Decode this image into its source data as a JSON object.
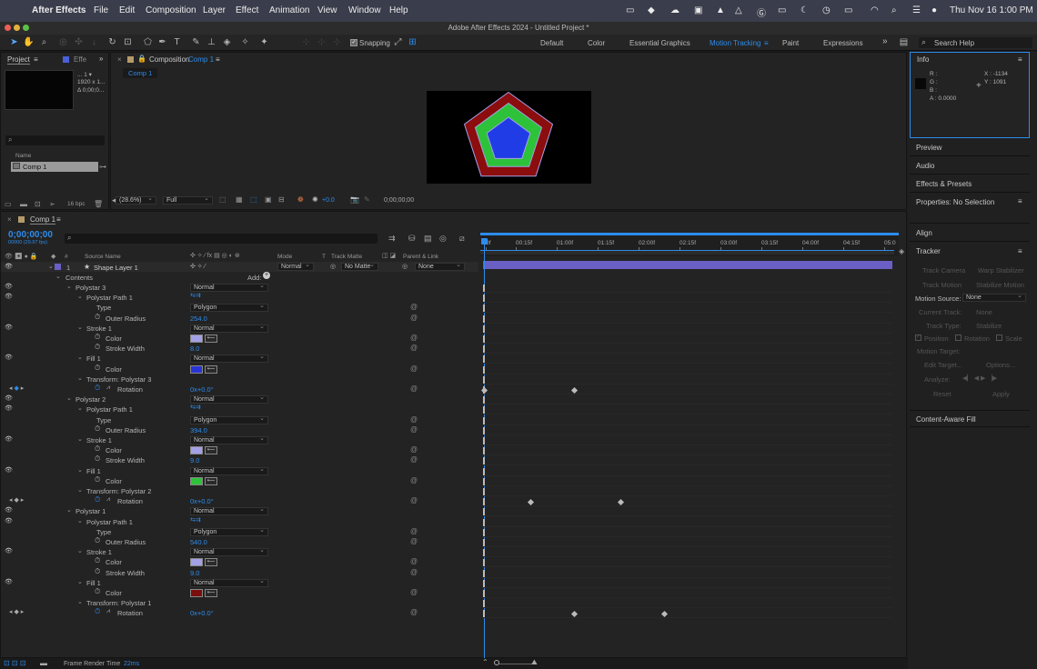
{
  "menubar": {
    "app": "After Effects",
    "items": [
      "File",
      "Edit",
      "Composition",
      "Layer",
      "Effect",
      "Animation",
      "View",
      "Window",
      "Help"
    ],
    "datetime": "Thu Nov 16  1:00 PM"
  },
  "window": {
    "title": "Adobe After Effects 2024 - Untitled Project *"
  },
  "toolbar": {
    "snapping": "Snapping",
    "workspaces": [
      "Default",
      "Color",
      "Essential Graphics",
      "Motion Tracking",
      "Paint",
      "Expressions"
    ],
    "active_workspace": "Motion Tracking",
    "more": "»",
    "search_placeholder": "Search Help"
  },
  "project": {
    "tab": "Project",
    "effects_tab": "Effe",
    "thumb_info": [
      "... 1 ▾",
      "1920 x 1...",
      "Δ 0;00;0..."
    ],
    "name_header": "Name",
    "item": "Comp 1",
    "bpc": "16 bpc"
  },
  "composition": {
    "tab_prefix": "Composition",
    "tab_name": "Comp 1",
    "breadcrumb": "Comp 1",
    "zoom": "(28.6%)",
    "resolution": "Full",
    "exposure": "+0.0",
    "timecode": "0;00;00;00"
  },
  "timeline": {
    "tab": "Comp 1",
    "timecode": "0;00;00;00",
    "fps": "00000 (29.97 fps)",
    "search_placeholder": "",
    "headers": {
      "num": "#",
      "source": "Source Name",
      "mode": "Mode",
      "t": "T",
      "trackmatte": "Track Matte",
      "parent": "Parent & Link"
    },
    "layer": {
      "num": "1",
      "name": "Shape Layer 1",
      "mode": "Normal",
      "matte": "No Matte",
      "parent": "None"
    },
    "contents": "Contents",
    "add": "Add:",
    "ruler": [
      "0f",
      "00:15f",
      "01:00f",
      "01:15f",
      "02:00f",
      "02:15f",
      "03:00f",
      "03:15f",
      "04:00f",
      "04:15f",
      "05:0"
    ],
    "rows": [
      {
        "indent": 1,
        "label": "Polystar 3",
        "dd": "Normal",
        "eye": true
      },
      {
        "indent": 2,
        "label": "Polystar Path 1",
        "pathicon": true,
        "eye": true
      },
      {
        "indent": 3,
        "label": "Type",
        "dd": "Polygon",
        "spiral": true
      },
      {
        "indent": 3,
        "label": "Outer Radius",
        "value": "254.0",
        "stop": true,
        "spiral": true
      },
      {
        "indent": 2,
        "label": "Stroke 1",
        "dd": "Normal",
        "eye": true
      },
      {
        "indent": 3,
        "label": "Color",
        "color": "#a3a0e6",
        "stop": true,
        "spiral": true
      },
      {
        "indent": 3,
        "label": "Stroke Width",
        "value": "8.0",
        "stop": true,
        "spiral": true
      },
      {
        "indent": 2,
        "label": "Fill 1",
        "dd": "Normal",
        "eye": true
      },
      {
        "indent": 3,
        "label": "Color",
        "color": "#2a34d4",
        "stop": true,
        "spiral": true
      },
      {
        "indent": 2,
        "label": "Transform: Polystar 3"
      },
      {
        "indent": 3,
        "label": "Rotation",
        "value": "0x+0.0°",
        "stop": true,
        "graph": true,
        "spiral": true,
        "keynav": true,
        "kfs": [
          531,
          630
        ]
      },
      {
        "indent": 1,
        "label": "Polystar 2",
        "dd": "Normal",
        "eye": true
      },
      {
        "indent": 2,
        "label": "Polystar Path 1",
        "pathicon": true,
        "eye": true
      },
      {
        "indent": 3,
        "label": "Type",
        "dd": "Polygon",
        "spiral": true
      },
      {
        "indent": 3,
        "label": "Outer Radius",
        "value": "394.0",
        "stop": true,
        "spiral": true
      },
      {
        "indent": 2,
        "label": "Stroke 1",
        "dd": "Normal",
        "eye": true
      },
      {
        "indent": 3,
        "label": "Color",
        "color": "#a3a0e6",
        "stop": true,
        "spiral": true
      },
      {
        "indent": 3,
        "label": "Stroke Width",
        "value": "9.0",
        "stop": true,
        "spiral": true
      },
      {
        "indent": 2,
        "label": "Fill 1",
        "dd": "Normal",
        "eye": true
      },
      {
        "indent": 3,
        "label": "Color",
        "color": "#2ec23a",
        "stop": true,
        "spiral": true
      },
      {
        "indent": 2,
        "label": "Transform: Polystar 2"
      },
      {
        "indent": 3,
        "label": "Rotation",
        "value": "0x+0.0°",
        "stop": true,
        "graph": true,
        "spiral": true,
        "keynav": true,
        "kfs": [
          582,
          681
        ]
      },
      {
        "indent": 1,
        "label": "Polystar 1",
        "dd": "Normal",
        "eye": true
      },
      {
        "indent": 2,
        "label": "Polystar Path 1",
        "pathicon": true,
        "eye": true
      },
      {
        "indent": 3,
        "label": "Type",
        "dd": "Polygon",
        "spiral": true
      },
      {
        "indent": 3,
        "label": "Outer Radius",
        "value": "540.0",
        "stop": true,
        "spiral": true
      },
      {
        "indent": 2,
        "label": "Stroke 1",
        "dd": "Normal",
        "eye": true
      },
      {
        "indent": 3,
        "label": "Color",
        "color": "#a3a0e6",
        "stop": true,
        "spiral": true
      },
      {
        "indent": 3,
        "label": "Stroke Width",
        "value": "9.0",
        "stop": true,
        "spiral": true
      },
      {
        "indent": 2,
        "label": "Fill 1",
        "dd": "Normal",
        "eye": true
      },
      {
        "indent": 3,
        "label": "Color",
        "color": "#7a0e0e",
        "stop": true,
        "spiral": true
      },
      {
        "indent": 2,
        "label": "Transform: Polystar 1"
      },
      {
        "indent": 3,
        "label": "Rotation",
        "value": "0x+0.0°",
        "stop": true,
        "graph": true,
        "spiral": true,
        "keynav": true,
        "kfs": [
          630,
          729
        ]
      }
    ],
    "status": {
      "label": "Frame Render Time",
      "value": "22ms"
    }
  },
  "info": {
    "tab": "Info",
    "r": "R :",
    "g": "G :",
    "b": "B :",
    "a": "A :  0.0000",
    "x": "X : -1134",
    "y": "Y : 1091"
  },
  "right_panels": {
    "preview": "Preview",
    "audio": "Audio",
    "effects": "Effects & Presets",
    "properties": "Properties: No Selection",
    "align": "Align",
    "tracker": "Tracker",
    "content_aware": "Content-Aware Fill"
  },
  "tracker": {
    "track_camera": "Track Camera",
    "warp": "Warp Stabilizer",
    "track_motion": "Track Motion",
    "stabilize": "Stabilize Motion",
    "motion_source_label": "Motion Source:",
    "motion_source": "None",
    "current_track_label": "Current Track:",
    "current_track": "None",
    "track_type_label": "Track Type:",
    "track_type": "Stabilize",
    "position": "Position",
    "rotation": "Rotation",
    "scale": "Scale",
    "motion_target": "Motion Target:",
    "edit_target": "Edit Target...",
    "options": "Options...",
    "analyze": "Analyze:",
    "reset": "Reset",
    "apply": "Apply"
  },
  "colors": {
    "accent": "#2d8ceb",
    "outer": "#8b0d0d",
    "middle": "#2ec23a",
    "inner": "#1f3ce6",
    "layer_bar": "#6a5fc4"
  }
}
